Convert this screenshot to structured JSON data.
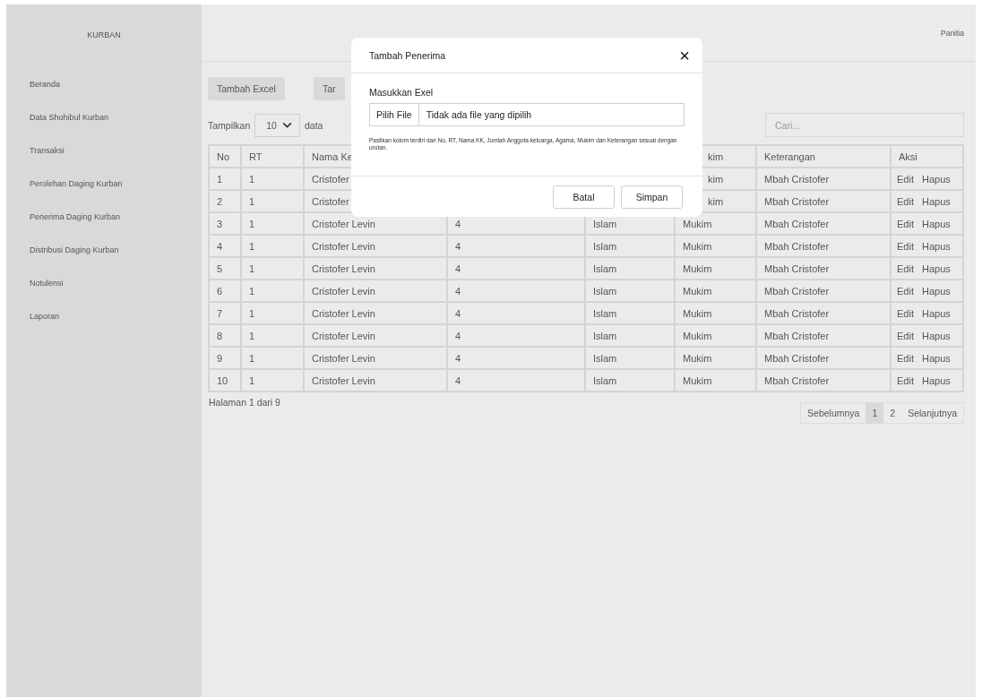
{
  "sidebar": {
    "brand": "KURBAN",
    "items": [
      {
        "label": "Beranda",
        "selected": false
      },
      {
        "label": "Data Shohibul Kurban",
        "selected": false
      },
      {
        "label": "Transaksi",
        "selected": false
      },
      {
        "label": "Perolehan Daging Kurban",
        "selected": false
      },
      {
        "label": "Penerima Daging Kurban",
        "selected": false
      },
      {
        "label": "Distribusi Daging Kurban",
        "selected": false
      },
      {
        "label": "Notulensi",
        "selected": false
      },
      {
        "label": "Laporan",
        "selected": false
      }
    ]
  },
  "topbar": {
    "user": "Panitia"
  },
  "actions": [
    "Tambah Excel",
    "Tar"
  ],
  "controls": {
    "show_label": "Tampilkan",
    "page_size": "10",
    "after_label": "data",
    "search": {
      "placeholder": "Cari..."
    }
  },
  "table": {
    "columns": [
      {
        "text": "No"
      },
      {
        "text": "RT"
      },
      {
        "text": "Nama Ke"
      },
      null,
      null,
      {
        "text": "kim",
        "cut_left": true
      },
      {
        "text": "Keterangan"
      },
      {
        "text": "Aksi"
      }
    ],
    "rows": [
      {
        "cells": [
          {
            "text": "1"
          },
          {
            "text": "1"
          },
          {
            "text": "Cristofer"
          },
          null,
          null,
          {
            "text": "kim",
            "cut_left": true
          },
          {
            "text": "Mbah Cristofer"
          }
        ],
        "actions": [
          "Edit",
          "Hapus"
        ]
      },
      {
        "cells": [
          {
            "text": "2"
          },
          {
            "text": "1"
          },
          {
            "text": "Cristofer"
          },
          null,
          null,
          {
            "text": "kim",
            "cut_left": true
          },
          {
            "text": "Mbah Cristofer"
          }
        ],
        "actions": [
          "Edit",
          "Hapus"
        ]
      },
      {
        "cells": [
          {
            "text": "3"
          },
          {
            "text": "1"
          },
          {
            "text": "Cristofer Levin"
          },
          {
            "text": "4"
          },
          {
            "text": "Islam"
          },
          {
            "text": "Mukim"
          },
          {
            "text": "Mbah Cristofer"
          }
        ],
        "actions": [
          "Edit",
          "Hapus"
        ]
      },
      {
        "cells": [
          {
            "text": "4"
          },
          {
            "text": "1"
          },
          {
            "text": "Cristofer Levin"
          },
          {
            "text": "4"
          },
          {
            "text": "Islam"
          },
          {
            "text": "Mukim"
          },
          {
            "text": "Mbah Cristofer"
          }
        ],
        "actions": [
          "Edit",
          "Hapus"
        ]
      },
      {
        "cells": [
          {
            "text": "5"
          },
          {
            "text": "1"
          },
          {
            "text": "Cristofer Levin"
          },
          {
            "text": "4"
          },
          {
            "text": "Islam"
          },
          {
            "text": "Mukim"
          },
          {
            "text": "Mbah Cristofer"
          }
        ],
        "actions": [
          "Edit",
          "Hapus"
        ]
      },
      {
        "cells": [
          {
            "text": "6"
          },
          {
            "text": "1"
          },
          {
            "text": "Cristofer Levin"
          },
          {
            "text": "4"
          },
          {
            "text": "Islam"
          },
          {
            "text": "Mukim"
          },
          {
            "text": "Mbah Cristofer"
          }
        ],
        "actions": [
          "Edit",
          "Hapus"
        ]
      },
      {
        "cells": [
          {
            "text": "7"
          },
          {
            "text": "1"
          },
          {
            "text": "Cristofer Levin"
          },
          {
            "text": "4"
          },
          {
            "text": "Islam"
          },
          {
            "text": "Mukim"
          },
          {
            "text": "Mbah Cristofer"
          }
        ],
        "actions": [
          "Edit",
          "Hapus"
        ]
      },
      {
        "cells": [
          {
            "text": "8"
          },
          {
            "text": "1"
          },
          {
            "text": "Cristofer Levin"
          },
          {
            "text": "4"
          },
          {
            "text": "Islam"
          },
          {
            "text": "Mukim"
          },
          {
            "text": "Mbah Cristofer"
          }
        ],
        "actions": [
          "Edit",
          "Hapus"
        ]
      },
      {
        "cells": [
          {
            "text": "9"
          },
          {
            "text": "1"
          },
          {
            "text": "Cristofer Levin"
          },
          {
            "text": "4"
          },
          {
            "text": "Islam"
          },
          {
            "text": "Mukim"
          },
          {
            "text": "Mbah Cristofer"
          }
        ],
        "actions": [
          "Edit",
          "Hapus"
        ]
      },
      {
        "cells": [
          {
            "text": "10"
          },
          {
            "text": "1"
          },
          {
            "text": "Cristofer Levin"
          },
          {
            "text": "4"
          },
          {
            "text": "Islam"
          },
          {
            "text": "Mukim"
          },
          {
            "text": "Mbah Cristofer"
          }
        ],
        "actions": [
          "Edit",
          "Hapus"
        ]
      }
    ]
  },
  "footer": {
    "page_info": "Halaman 1 dari 9",
    "pagination": [
      {
        "label": "Sebelumnya",
        "selected": false
      },
      {
        "label": "1",
        "selected": true
      },
      {
        "label": "2",
        "selected": false
      },
      {
        "label": "Selanjutnya",
        "selected": false
      }
    ]
  },
  "dialog": {
    "title": "Tambah Penerima",
    "close": "×",
    "field_label": "Masukkan Exel",
    "file_button": "Pilih File",
    "file_status": "Tidak ada file yang dipilih",
    "note": "Pastikan kolom terdiri dari  No, RT, Nama KK, Jumlah Anggota keluarga, Agama, Mukim dan Keterangan sesuai dengan urutan.",
    "buttons": [
      "Batal",
      "Simpan"
    ]
  }
}
